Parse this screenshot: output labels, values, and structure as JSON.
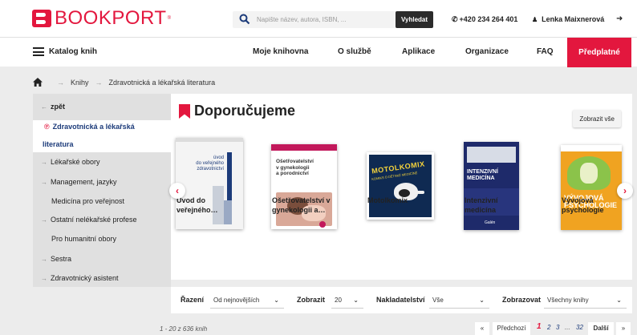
{
  "header": {
    "logo_text": "BOOKPORT",
    "logo_mark": "®",
    "search": {
      "placeholder": "Napište název, autora, ISBN, ...",
      "button": "Vyhledat"
    },
    "phone": "+420 234 264 401",
    "user": "Lenka Maixnerová"
  },
  "nav": {
    "catalog": "Katalog knih",
    "items": [
      "Moje knihovna",
      "O službě",
      "Aplikace",
      "Organizace",
      "FAQ"
    ],
    "active": "Předplatné"
  },
  "breadcrumb": [
    "Knihy",
    "Zdravotnická a lékařská literatura"
  ],
  "sidebar": {
    "back": "zpět",
    "active_line1": "Zdravotnická a lékařská",
    "active_line2": "literatura",
    "items": [
      "Lékařské obory",
      "Management, jazyky",
      "Medicína pro veřejnost",
      "Ostatní nelékařské profese",
      "Pro humanitní obory",
      "Sestra",
      "Zdravotnický asistent"
    ]
  },
  "main": {
    "title": "Doporučujeme",
    "show_all": "Zobrazit vše",
    "books": [
      {
        "line1": "Úvod do",
        "line2": "veřejného…",
        "cover_line1": "úvod",
        "cover_line2": "do veřejného",
        "cover_line3": "zdravotnictví"
      },
      {
        "line1": "Ošetřovatelství v",
        "line2": "gynekologii a…",
        "cover_line1": "Ošetřovatelství",
        "cover_line2": "v gynekologii",
        "cover_line3": "a porodnictví"
      },
      {
        "line1": "Motolkomix",
        "line2": "",
        "cover_line1": "MOTOLKOMIX",
        "cover_line2": "KOMIKS O DĚTSKÉ MEDICÍNĚ",
        "cover_line3": ""
      },
      {
        "line1": "Intenzivní",
        "line2": "medicína",
        "cover_line1": "INTENZIVNÍ",
        "cover_line2": "MEDICÍNA",
        "cover_line3": "Galén"
      },
      {
        "line1": "Vývojová",
        "line2": "psychologie",
        "cover_line1": "VÝVOJOVÁ",
        "cover_line2": "PSYCHOLOGIE",
        "cover_line3": ""
      }
    ]
  },
  "filter": {
    "sort_label": "Řazení",
    "sort_value": "Od nejnovějších",
    "show_label": "Zobrazit",
    "show_value": "20",
    "publisher_label": "Nakladatelství",
    "publisher_value": "Vše",
    "view_label": "Zobrazovat",
    "view_value": "Všechny knihy"
  },
  "pagination": {
    "count": "1 - 20 z 636 knih",
    "first": "«",
    "prev": "Předchozí",
    "current": "1",
    "pages": [
      "2",
      "3",
      "...",
      "32"
    ],
    "next": "Další",
    "last": "»"
  },
  "colors": {
    "brand": "#e3173e",
    "navy": "#1c3b7a"
  }
}
